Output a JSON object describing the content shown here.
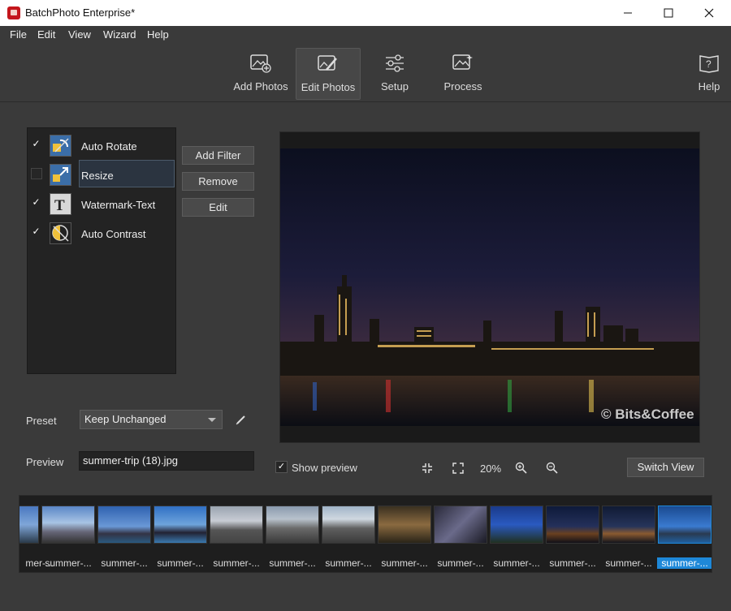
{
  "window": {
    "title": "BatchPhoto Enterprise*",
    "minimize_icon": "minimize-icon",
    "maximize_icon": "maximize-icon",
    "close_icon": "close-icon"
  },
  "menu": [
    "File",
    "Edit",
    "View",
    "Wizard",
    "Help"
  ],
  "toolbar": {
    "add_photos": "Add Photos",
    "edit_photos": "Edit Photos",
    "setup": "Setup",
    "process": "Process",
    "help": "Help"
  },
  "filters": [
    {
      "name": "Auto Rotate",
      "checked": true,
      "icon": "auto-rotate-icon"
    },
    {
      "name": "Resize",
      "checked": false,
      "icon": "resize-icon"
    },
    {
      "name": "Watermark-Text",
      "checked": true,
      "icon": "text-icon"
    },
    {
      "name": "Auto Contrast",
      "checked": true,
      "icon": "contrast-icon"
    }
  ],
  "filter_buttons": {
    "add": "Add Filter",
    "remove": "Remove",
    "edit": "Edit"
  },
  "preset": {
    "label": "Preset",
    "value": "Keep Unchanged"
  },
  "preview_field": {
    "label": "Preview",
    "value": "summer-trip (18).jpg"
  },
  "preview_controls": {
    "show_preview_label": "Show preview",
    "show_preview_checked": true,
    "zoom": "20%",
    "switch_view": "Switch View"
  },
  "watermark_text": "© Bits&Coffee",
  "thumbnails": [
    "mer-...",
    "summer-...",
    "summer-...",
    "summer-...",
    "summer-...",
    "summer-...",
    "summer-...",
    "summer-...",
    "summer-...",
    "summer-...",
    "summer-...",
    "summer-...",
    "summer-..."
  ]
}
